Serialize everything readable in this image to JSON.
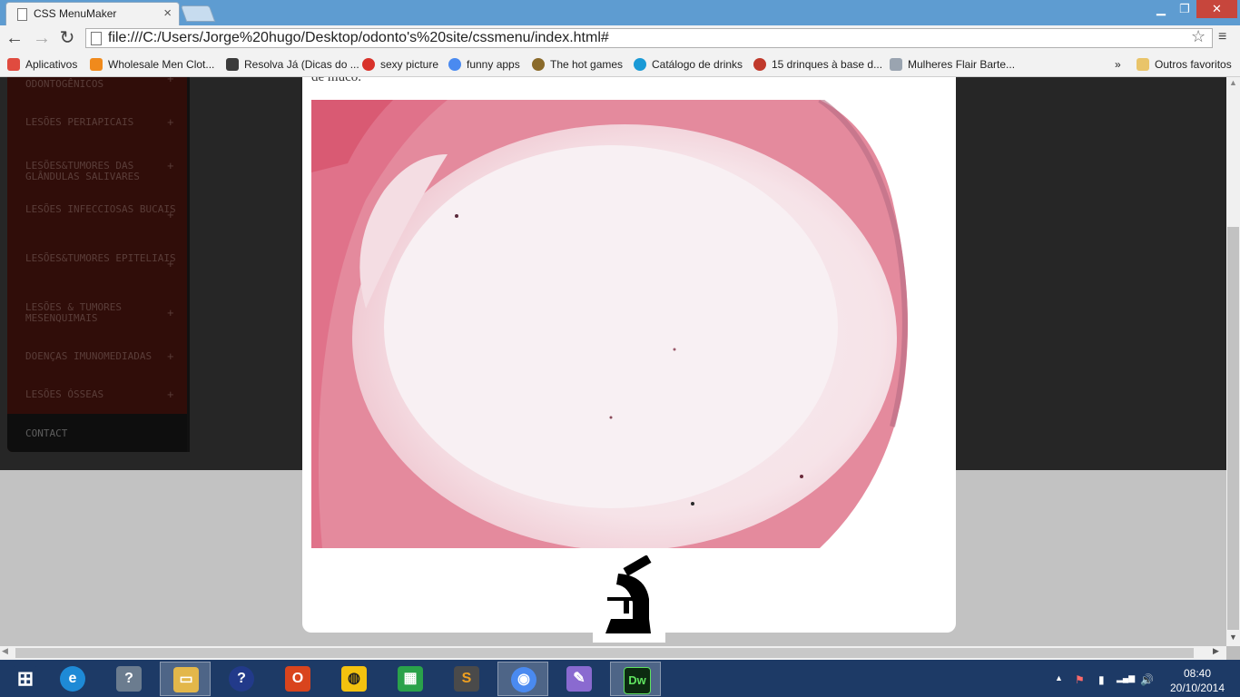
{
  "browser": {
    "tab_title": "CSS MenuMaker",
    "tab_close": "×",
    "window_controls": {
      "minimize": "▁",
      "maximize": "❐",
      "close": "✕"
    },
    "nav": {
      "back": "←",
      "forward": "→",
      "reload": "↻",
      "star": "☆",
      "menu": "≡"
    },
    "url": "file:///C:/Users/Jorge%20hugo/Desktop/odonto's%20site/cssmenu/index.html#"
  },
  "bookmarks": [
    {
      "label": "Aplicativos",
      "icon": "apps-grid-icon",
      "color": "#e04b3f"
    },
    {
      "label": "Wholesale Men Clot...",
      "icon": "cart-icon",
      "color": "#f08a1c"
    },
    {
      "label": "Resolva Já (Dicas do ...",
      "icon": "eye-icon",
      "color": "#3b3b3b"
    },
    {
      "label": "sexy picture",
      "icon": "pin-icon",
      "color": "#d8322a"
    },
    {
      "label": "funny apps",
      "icon": "chrome-icon",
      "color": "#4a8af0"
    },
    {
      "label": "The hot games",
      "icon": "bear-icon",
      "color": "#8a6a2a"
    },
    {
      "label": "Catálogo de drinks",
      "icon": "k-icon",
      "color": "#1a9ad6"
    },
    {
      "label": "15 drinques à base d...",
      "icon": "target-icon",
      "color": "#c0392b"
    },
    {
      "label": "Mulheres Flair Barte...",
      "icon": "page-icon",
      "color": "#9aa4b0"
    }
  ],
  "bookmarks_overflow": "»",
  "other_bookmarks": "Outros favoritos",
  "sidebar": {
    "items": [
      {
        "label": "ODONTOGÊNICOS"
      },
      {
        "label": "LESÕES PERIAPICAIS"
      },
      {
        "label": "LESÕES&TUMORES DAS GLÂNDULAS SALIVARES"
      },
      {
        "label": "LESÕES INFECCIOSAS BUCAIS"
      },
      {
        "label": "LESÕES&TUMORES EPITELIAIS"
      },
      {
        "label": "LESÕES & TUMORES MESENQUIMAIS"
      },
      {
        "label": "DOENÇAS IMUNOMEDIADAS"
      },
      {
        "label": "LESÕES ÓSSEAS"
      }
    ],
    "plus": "+",
    "contact": "CONTACT"
  },
  "content": {
    "text": "de muco."
  },
  "taskbar": {
    "apps": [
      {
        "name": "windows-start",
        "glyph": "⊞",
        "color": "#1d3a66"
      },
      {
        "name": "internet-explorer",
        "glyph": "e",
        "color": "#1e8ad6"
      },
      {
        "name": "help-bell",
        "glyph": "?",
        "color": "#6b7c8f"
      },
      {
        "name": "file-explorer",
        "glyph": "▭",
        "color": "#e3b74a"
      },
      {
        "name": "help-circle",
        "glyph": "?",
        "color": "#223a8a"
      },
      {
        "name": "office",
        "glyph": "O",
        "color": "#d9441d"
      },
      {
        "name": "globe-app",
        "glyph": "◍",
        "color": "#f3c20f"
      },
      {
        "name": "store",
        "glyph": "▦",
        "color": "#2aa24a"
      },
      {
        "name": "sublime",
        "glyph": "S",
        "color": "#4a4a4a"
      },
      {
        "name": "chrome",
        "glyph": "◉",
        "color": "#4a8af0"
      },
      {
        "name": "paint",
        "glyph": "✎",
        "color": "#8a6ad0"
      },
      {
        "name": "dreamweaver",
        "glyph": "Dw",
        "color": "#0c2a10"
      }
    ],
    "tray": {
      "up": "▲",
      "flag": "⚑",
      "network": "▂▄▆",
      "volume": "🔊",
      "battery": "▮"
    },
    "time": "08:40",
    "date": "20/10/2014"
  },
  "colors": {
    "titlebar": "#5e9cd1",
    "sidebar_bg": "#300d09",
    "page_dark": "#262626",
    "page_gray": "#c2c2c2",
    "taskbar": "#1d3a66"
  }
}
